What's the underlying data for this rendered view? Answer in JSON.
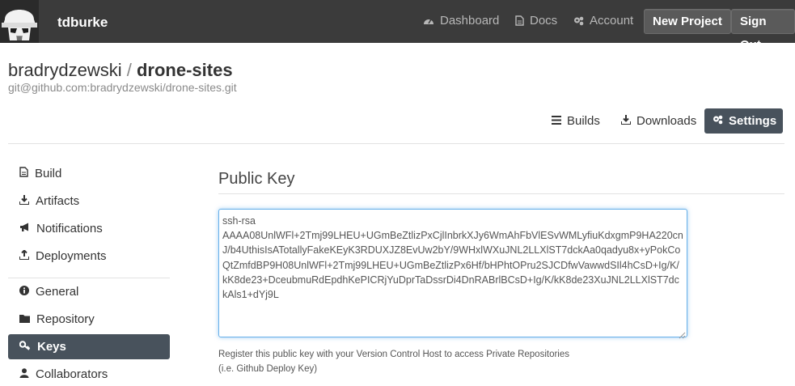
{
  "topbar": {
    "username": "tdburke",
    "links": [
      {
        "icon": "dashboard-icon",
        "label": "Dashboard"
      },
      {
        "icon": "document-icon",
        "label": "Docs"
      },
      {
        "icon": "gears-icon",
        "label": "Account"
      }
    ],
    "new_project_label": "New Project",
    "sign_out_label": "Sign Out"
  },
  "repo": {
    "owner": "bradrydzewski",
    "separator": "/",
    "name": "drone-sites",
    "url": "git@github.com:bradrydzewski/drone-sites.git"
  },
  "tabs": [
    {
      "icon": "list-icon",
      "label": "Builds",
      "active": false
    },
    {
      "icon": "download-icon",
      "label": "Downloads",
      "active": false
    },
    {
      "icon": "gears-icon",
      "label": "Settings",
      "active": true
    }
  ],
  "sidebar": {
    "items": [
      {
        "icon": "file-icon",
        "label": "Build"
      },
      {
        "icon": "download-icon",
        "label": "Artifacts"
      },
      {
        "icon": "bullhorn-icon",
        "label": "Notifications"
      },
      {
        "icon": "upload-icon",
        "label": "Deployments"
      },
      {
        "icon": "info-icon",
        "label": "General"
      },
      {
        "icon": "folder-icon",
        "label": "Repository"
      },
      {
        "icon": "key-icon",
        "label": "Keys",
        "active": true
      },
      {
        "icon": "user-icon",
        "label": "Collaborators"
      }
    ]
  },
  "main": {
    "title": "Public Key",
    "public_key": "ssh-rsa\nAAAA08UnlWFl+2Tmj99LHEU+UGmBeZtlizPxCjlInbrkXJy6WmAhFbVlESvWMLyfiuKdxgmP9HA220cnJ/b4UthisIsATotallyFakeKEyK3RDUXJZ8EvUw2bY/9WHxlWXuJNL2LLXlST7dckAa0qadyu8x+yPokCoQtZmfdBP9H08UnlWFl+2Tmj99LHEU+UGmBeZtlizPx6Hf/bHPhtOPru2SJCDfwVawwdSIl4hCsD+Ig/K/kK8de23+DceubmuRdEpdhKePICRjYuDprTaDssrDi4DnRABrlBCsD+Ig/K/kK8de23XuJNL2LLXlST7dckAls1+dYj9L",
    "help_line1": "Register this public key with your Version Control Host to access Private Repositories",
    "help_line2": "(i.e. Github Deploy Key)"
  }
}
